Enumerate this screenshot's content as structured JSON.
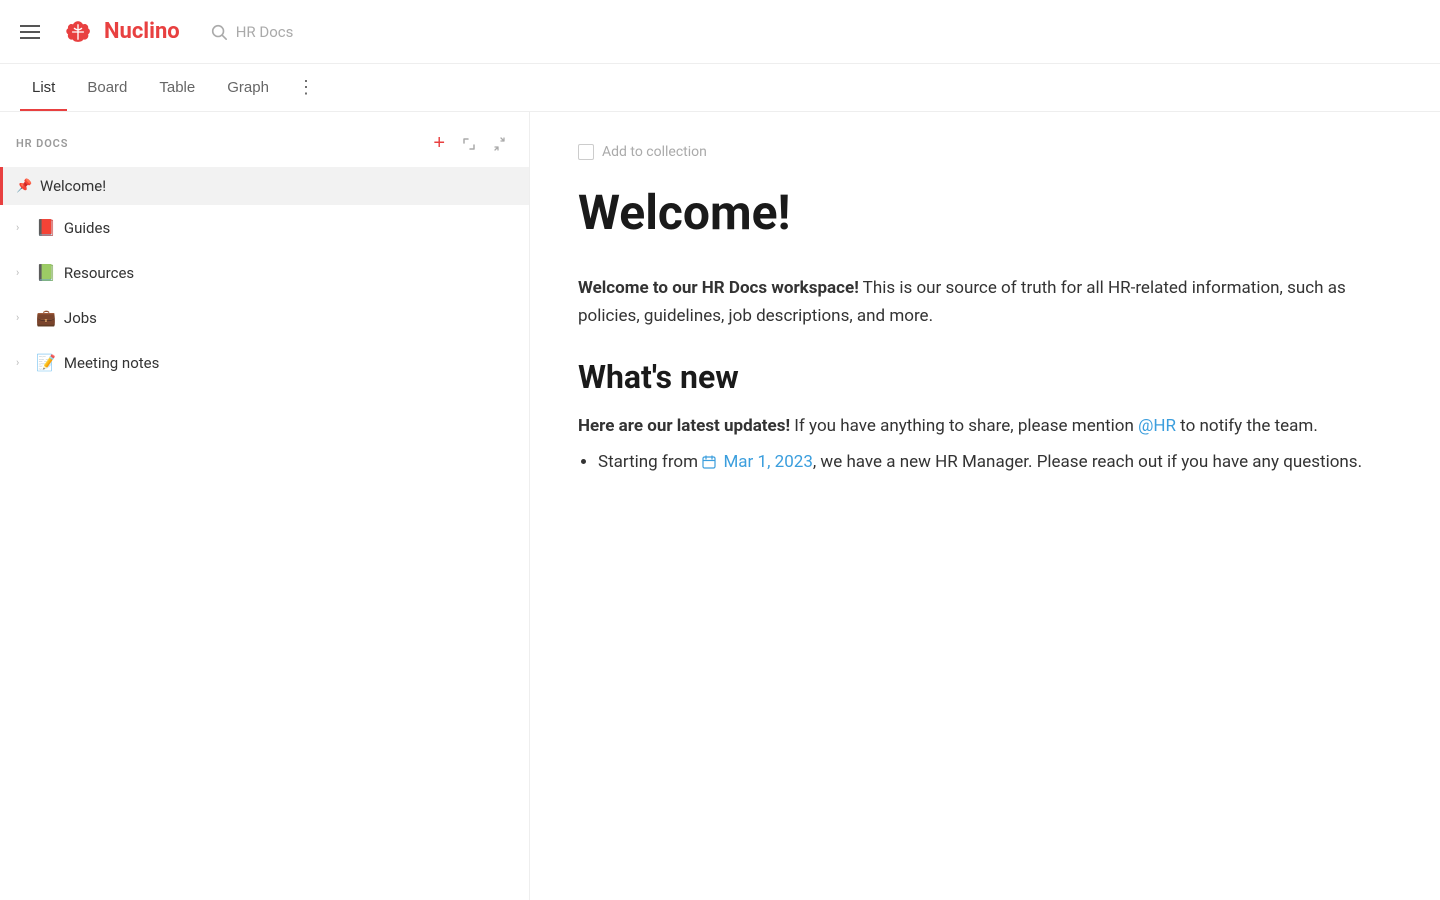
{
  "app": {
    "name": "Nuclino",
    "search_placeholder": "HR Docs"
  },
  "tabs": [
    {
      "id": "list",
      "label": "List",
      "active": true
    },
    {
      "id": "board",
      "label": "Board",
      "active": false
    },
    {
      "id": "table",
      "label": "Table",
      "active": false
    },
    {
      "id": "graph",
      "label": "Graph",
      "active": false
    }
  ],
  "sidebar": {
    "title": "HR DOCS",
    "add_label": "+",
    "items": [
      {
        "id": "welcome",
        "label": "Welcome!",
        "pinned": true,
        "emoji": "",
        "active": true
      },
      {
        "id": "guides",
        "label": "Guides",
        "emoji": "📕",
        "has_children": true
      },
      {
        "id": "resources",
        "label": "Resources",
        "emoji": "📗",
        "has_children": true
      },
      {
        "id": "jobs",
        "label": "Jobs",
        "emoji": "💼",
        "has_children": true
      },
      {
        "id": "meeting-notes",
        "label": "Meeting notes",
        "emoji": "📝",
        "has_children": true
      }
    ]
  },
  "content": {
    "add_to_collection_label": "Add to collection",
    "title": "Welcome!",
    "body_intro_bold": "Welcome to our HR Docs workspace!",
    "body_intro_rest": " This is our source of truth for all HR-related information, such as policies, guidelines, job descriptions, and more.",
    "whats_new_heading": "What's new",
    "updates_bold": "Here are our latest updates!",
    "updates_rest": " If you have anything to share, please mention ",
    "at_hr": "@HR",
    "updates_after_link": " to notify the team.",
    "bullet_1_before": "Starting from ",
    "bullet_1_date": "Mar 1, 2023",
    "bullet_1_after": ", we have a new HR Manager. Please reach out if you have any questions."
  },
  "icons": {
    "hamburger": "☰",
    "search": "🔍",
    "more_dots": "⋮",
    "expand": "⤢",
    "collapse": "«",
    "copy": "⧉",
    "pin": "📌",
    "calendar": "📅"
  }
}
